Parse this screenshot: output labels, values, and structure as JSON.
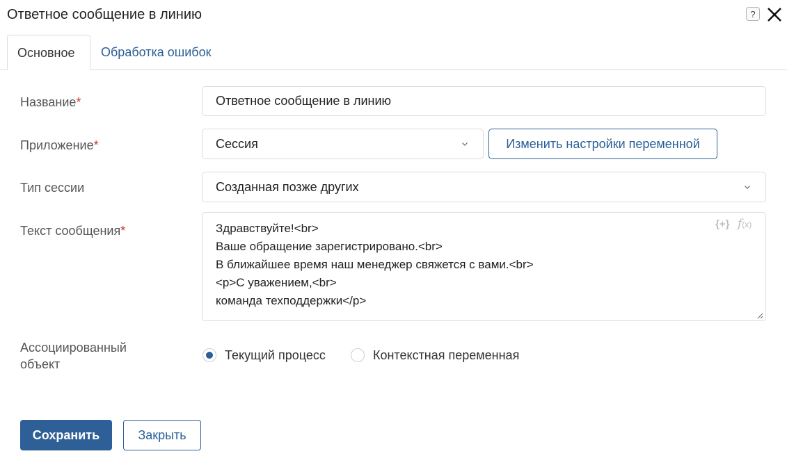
{
  "dialog": {
    "title": "Ответное сообщение в линию",
    "help_icon": "help-icon",
    "help_glyph": "?",
    "close_icon": "close-icon"
  },
  "tabs": [
    {
      "label": "Основное",
      "active": true
    },
    {
      "label": "Обработка ошибок",
      "active": false
    }
  ],
  "form": {
    "name": {
      "label": "Название",
      "required_mark": "*",
      "value": "Ответное сообщение в линию"
    },
    "app": {
      "label": "Приложение",
      "required_mark": "*",
      "value": "Сессия",
      "button_label": "Изменить настройки переменной"
    },
    "session_type": {
      "label": "Тип сессии",
      "value": "Созданная позже других"
    },
    "message": {
      "label": "Текст сообщения",
      "required_mark": "*",
      "lines": [
        "Здравствуйте!<br>",
        "Ваше обращение зарегистрировано.<br>",
        "В ближайшее время наш менеджер свяжется с вами.<br>",
        "<p>С уважением,<br>",
        "команда техподдержки</p>"
      ],
      "var_icon_text": "{+}",
      "fx_icon_text": "f",
      "fx_icon_suffix": "(x)"
    },
    "assoc": {
      "label_line1": "Ассоциированный",
      "label_line2": "объект",
      "options": [
        {
          "label": "Текущий процесс",
          "checked": true
        },
        {
          "label": "Контекстная переменная",
          "checked": false
        }
      ]
    }
  },
  "footer": {
    "save_label": "Сохранить",
    "close_label": "Закрыть"
  },
  "colors": {
    "accent": "#2e5f96",
    "required": "#d0332b",
    "border": "#dcdcdc"
  }
}
